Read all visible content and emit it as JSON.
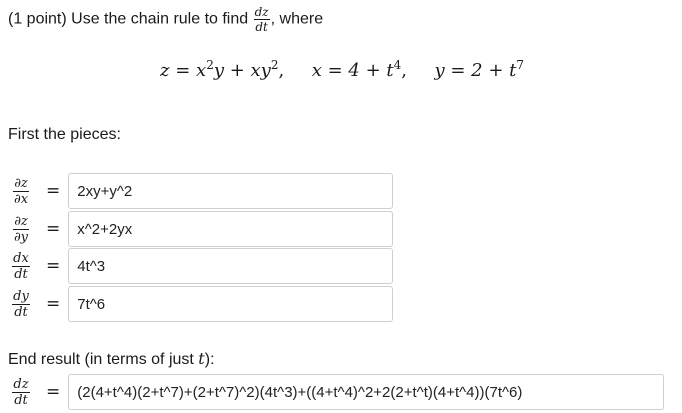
{
  "problem": {
    "points": "(1 point)",
    "instruction": "Use the chain rule to find",
    "target_num": "dz",
    "target_den": "dt",
    "after": ", where"
  },
  "equation": {
    "eq1_lhs": "z",
    "eq1_rhs_a": "x",
    "eq1_rhs_a_exp": "2",
    "eq1_rhs_b": "y + xy",
    "eq1_rhs_b_exp": "2",
    "eq2_lhs": "x",
    "eq2_rhs": "4 + t",
    "eq2_exp": "4",
    "eq3_lhs": "y",
    "eq3_rhs": "2 + t",
    "eq3_exp": "7"
  },
  "pieces_heading": "First the pieces:",
  "pieces": [
    {
      "num": "∂z",
      "den": "∂x",
      "value": "2xy+y^2"
    },
    {
      "num": "∂z",
      "den": "∂y",
      "value": "x^2+2yx"
    },
    {
      "num": "dx",
      "den": "dt",
      "value": "4t^3"
    },
    {
      "num": "dy",
      "den": "dt",
      "value": "7t^6"
    }
  ],
  "equals_sign": "=",
  "result": {
    "heading_prefix": "End result (in terms of just ",
    "heading_var": "t",
    "heading_suffix": "):",
    "num": "dz",
    "den": "dt",
    "value": "(2(4+t^4)(2+t^7)+(2+t^7)^2)(4t^3)+((4+t^4)^2+2(2+t^t)(4+t^4))(7t^6)"
  }
}
